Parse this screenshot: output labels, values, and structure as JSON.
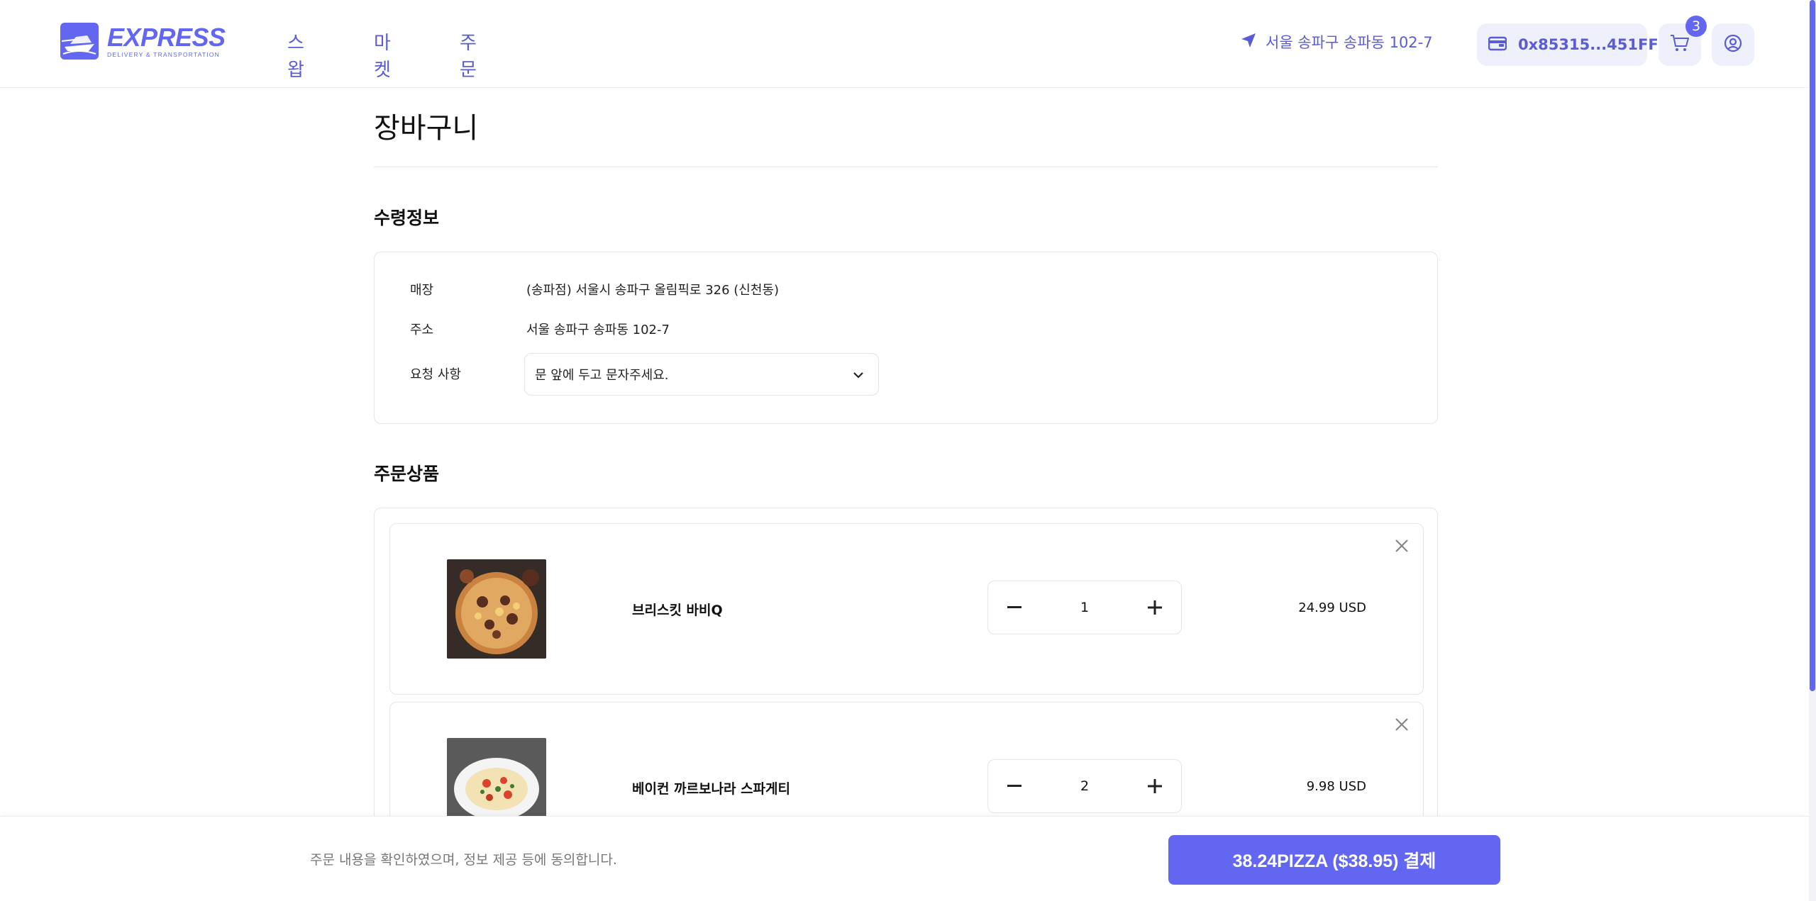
{
  "header": {
    "logo": {
      "name": "EXPRESS",
      "tagline": "DELIVERY & TRANSPORTATION"
    },
    "nav": [
      {
        "label": "스왑"
      },
      {
        "label": "마켓"
      },
      {
        "label": "주문"
      }
    ],
    "location": "서울 송파구 송파동 102-7",
    "wallet": "0x85315...451FF",
    "cart_count": "3",
    "colors": {
      "accent": "#6366f1",
      "accent_text": "#5b5bd6",
      "chip_bg": "#eef0fb"
    }
  },
  "page": {
    "title": "장바구니"
  },
  "delivery_info": {
    "title": "수령정보",
    "rows": [
      {
        "label": "매장",
        "value": "(송파점) 서울시 송파구 올림픽로 326 (신천동)"
      },
      {
        "label": "주소",
        "value": "서울 송파구 송파동 102-7"
      },
      {
        "label": "요청 사항",
        "value": "문 앞에 두고 문자주세요."
      }
    ]
  },
  "order_items": {
    "title": "주문상품",
    "items": [
      {
        "name": "브리스킷 바비Q",
        "quantity": "1",
        "price": "24.99 USD",
        "image": "pizza-icon"
      },
      {
        "name": "베이컨 까르보나라 스파게티",
        "quantity": "2",
        "price": "9.98 USD",
        "image": "pasta-icon"
      }
    ]
  },
  "footer": {
    "agreement": "주문 내용을 확인하였으며, 정보 제공 등에 동의합니다.",
    "pay_label": "38.24PIZZA ($38.95) 결제"
  }
}
